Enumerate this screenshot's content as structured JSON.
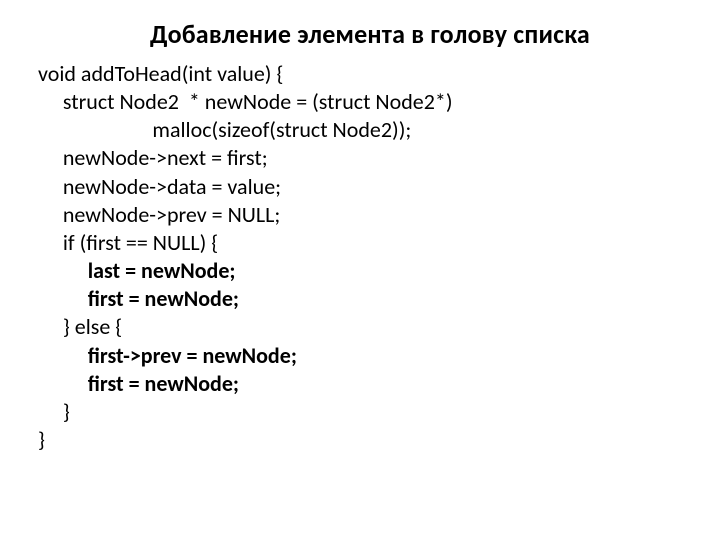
{
  "title": "Добавление элемента в голову списка",
  "code": {
    "l1": "void addToHead(int value) {",
    "l2": "     struct Node2  * newNode = (struct Node2*)",
    "l3": "                       malloc(sizeof(struct Node2));",
    "l4": "     newNode->next = first;",
    "l5": "     newNode->data = value;",
    "l6": "     newNode->prev = NULL;",
    "l7": "",
    "l8": "     if (first == NULL) {",
    "l9": "          last = newNode;",
    "l10": "          first = newNode;",
    "l11": "     } else {",
    "l12": "          first->prev = newNode;",
    "l13": "          first = newNode;",
    "l14": "     }",
    "l15": "}"
  }
}
